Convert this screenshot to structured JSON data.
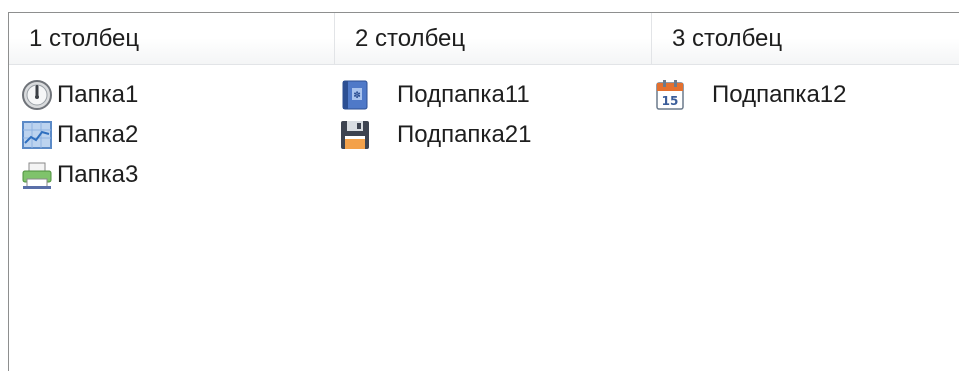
{
  "columns": [
    {
      "label": "1 столбец"
    },
    {
      "label": "2 столбец"
    },
    {
      "label": "3 столбец"
    }
  ],
  "column1": {
    "items": [
      {
        "label": "Папка1",
        "icon": "clock-icon"
      },
      {
        "label": "Папка2",
        "icon": "chart-icon"
      },
      {
        "label": "Папка3",
        "icon": "printer-icon"
      }
    ]
  },
  "column2": {
    "items": [
      {
        "label": "Подпапка11",
        "icon": "notebook-icon"
      },
      {
        "label": "Подпапка21",
        "icon": "floppy-disk-icon"
      }
    ]
  },
  "column3": {
    "items": [
      {
        "label": "Подпапка12",
        "icon": "calendar-icon",
        "icon_text": "15"
      }
    ]
  }
}
